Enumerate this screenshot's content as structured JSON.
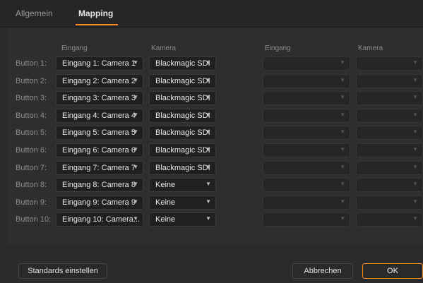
{
  "tabs": [
    {
      "label": "Allgemein",
      "active": false
    },
    {
      "label": "Mapping",
      "active": true
    }
  ],
  "accent_color": "#ff8a1c",
  "columns": {
    "input_left": "Eingang",
    "camera_left": "Kamera",
    "input_right": "Eingang",
    "camera_right": "Kamera"
  },
  "rows": [
    {
      "label": "Button 1:",
      "input": "Eingang 1: Camera 1",
      "camera": "Blackmagic SDI"
    },
    {
      "label": "Button 2:",
      "input": "Eingang 2: Camera 2",
      "camera": "Blackmagic SDI"
    },
    {
      "label": "Button 3:",
      "input": "Eingang 3: Camera 3",
      "camera": "Blackmagic SDI"
    },
    {
      "label": "Button 4:",
      "input": "Eingang 4: Camera 4",
      "camera": "Blackmagic SDI"
    },
    {
      "label": "Button 5:",
      "input": "Eingang 5: Camera 5",
      "camera": "Blackmagic SDI"
    },
    {
      "label": "Button 6:",
      "input": "Eingang 6: Camera 6",
      "camera": "Blackmagic SDI"
    },
    {
      "label": "Button 7:",
      "input": "Eingang 7: Camera 7",
      "camera": "Blackmagic SDI"
    },
    {
      "label": "Button 8:",
      "input": "Eingang 8: Camera 8",
      "camera": "Keine"
    },
    {
      "label": "Button 9:",
      "input": "Eingang 9: Camera 9",
      "camera": "Keine"
    },
    {
      "label": "Button 10:",
      "input": "Eingang 10: Camera...",
      "camera": "Keine"
    }
  ],
  "buttons": {
    "defaults": "Standards einstellen",
    "cancel": "Abbrechen",
    "ok": "OK"
  }
}
